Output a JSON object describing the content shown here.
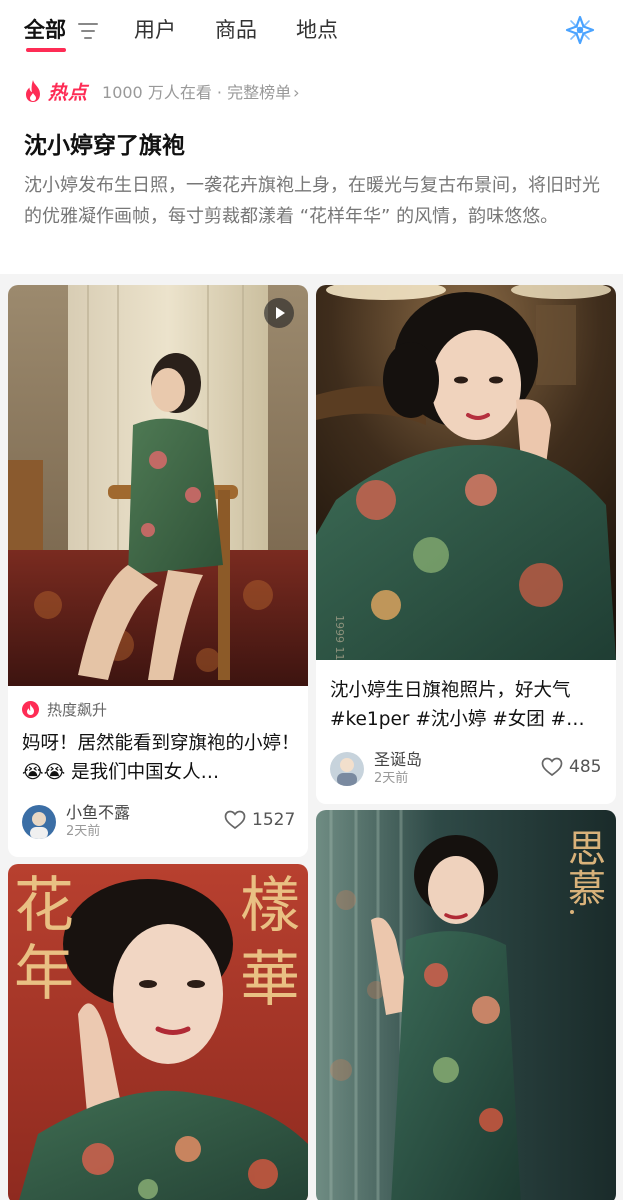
{
  "tabs": [
    {
      "label": "全部",
      "active": true
    },
    {
      "label": "用户",
      "active": false
    },
    {
      "label": "商品",
      "active": false
    },
    {
      "label": "地点",
      "active": false
    }
  ],
  "icons": {
    "filter": "filter-icon",
    "sparkle": "sparkle-icon",
    "fire": "fire-icon",
    "play": "play-icon",
    "heart": "heart-icon"
  },
  "colors": {
    "accent": "#fe2c55",
    "sparkle": "#4aa3ff",
    "muted": "#999999"
  },
  "hot": {
    "label": "热点",
    "stats": "1000 万人在看 · 完整榜单",
    "chevron": "›",
    "title": "沈小婷穿了旗袍",
    "description": "沈小婷发布生日照，一袭花卉旗袍上身，在暖光与复古布景间，将旧时光的优雅凝作画帧，每寸剪裁都漾着 “花样年华” 的风情，韵味悠悠。"
  },
  "cards": [
    {
      "has_video": true,
      "trend": "热度飙升",
      "title": "妈呀！居然能看到穿旗袍的小婷！😭😭 是我们中国女人…",
      "author": "小鱼不露",
      "time": "2天前",
      "likes": "1527"
    },
    {
      "has_video": false,
      "title": "沈小婷生日旗袍照片，好大气 #ke1per #沈小婷 #女团 #…",
      "author": "圣诞岛",
      "time": "2天前",
      "likes": "485"
    },
    {
      "has_video": false,
      "poster_text_left": "花年",
      "poster_text_right": "樣華"
    },
    {
      "has_video": false,
      "poster_text_right": "思慕"
    }
  ]
}
